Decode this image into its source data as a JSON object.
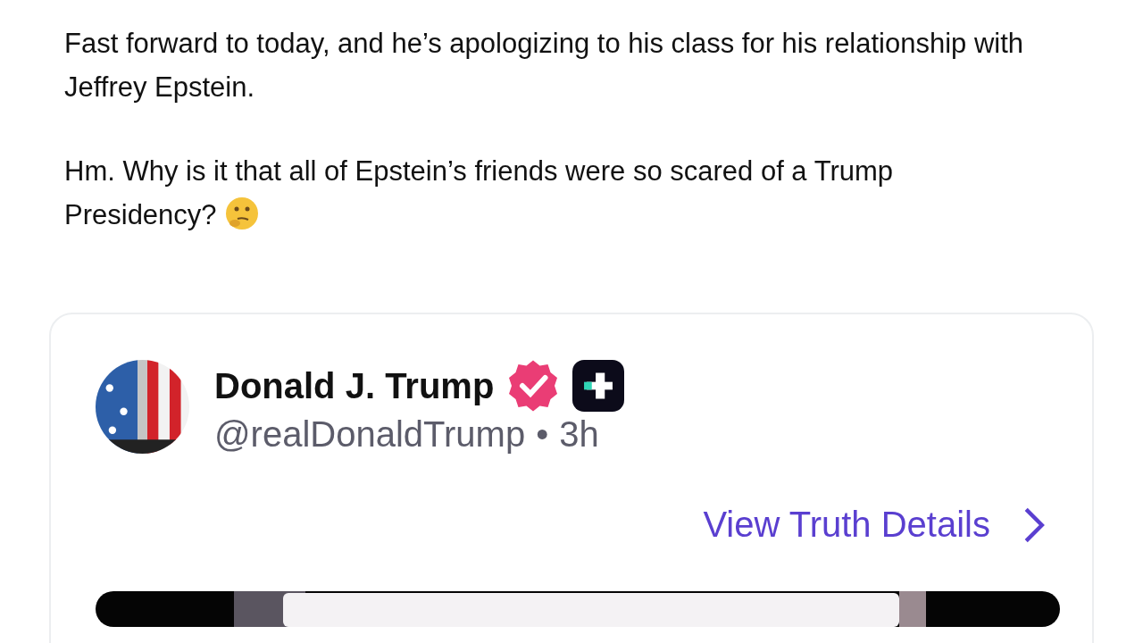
{
  "post": {
    "paragraphs": [
      "Fast forward to today, and he’s apologizing to his class for his relationship with Jeffrey Epstein.",
      "Hm. Why is it that all of Epstein’s friends were so scared of a Trump Presidency?"
    ]
  },
  "embed": {
    "name": "Donald J. Trump",
    "verified": true,
    "handle": "@realDonaldTrump",
    "separator": "•",
    "time": "3h",
    "link": "View Truth Details"
  }
}
